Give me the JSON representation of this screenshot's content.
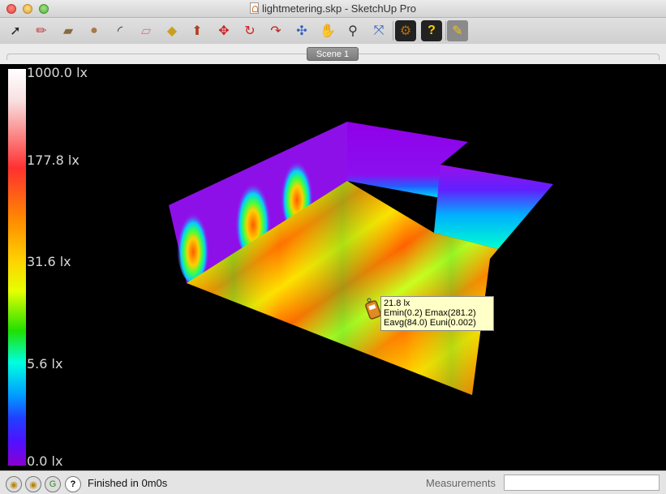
{
  "window": {
    "title": "lightmetering.skp - SketchUp Pro"
  },
  "toolbar": {
    "tools": [
      {
        "name": "select-tool",
        "glyph": "➚"
      },
      {
        "name": "pencil-tool",
        "glyph": "✏"
      },
      {
        "name": "rectangle-tool",
        "glyph": "▰"
      },
      {
        "name": "circle-tool",
        "glyph": "●"
      },
      {
        "name": "arc-tool",
        "glyph": "◜"
      },
      {
        "name": "eraser-tool",
        "glyph": "▱"
      },
      {
        "name": "paint-bucket-tool",
        "glyph": "◆"
      },
      {
        "name": "push-pull-tool",
        "glyph": "⬆"
      },
      {
        "name": "move-tool",
        "glyph": "✥"
      },
      {
        "name": "rotate-tool",
        "glyph": "↻"
      },
      {
        "name": "follow-me-tool",
        "glyph": "↷"
      },
      {
        "name": "orbit-tool",
        "glyph": "✣"
      },
      {
        "name": "pan-tool",
        "glyph": "✋"
      },
      {
        "name": "zoom-tool",
        "glyph": "⚲"
      },
      {
        "name": "zoom-extents-tool",
        "glyph": "⤧"
      },
      {
        "name": "settings-tool",
        "glyph": "⚙"
      },
      {
        "name": "help-tool",
        "glyph": "?"
      },
      {
        "name": "light-meter-tool",
        "glyph": "✎"
      }
    ]
  },
  "scenes": {
    "tabs": [
      "Scene 1"
    ]
  },
  "legend": {
    "labels": [
      "1000.0 lx",
      "177.8 lx",
      "31.6 lx",
      "5.6 lx",
      "0.0 lx"
    ]
  },
  "tooltip": {
    "line1": "21.8 lx",
    "line2": "Emin(0.2) Emax(281.2)",
    "line3": "Eavg(84.0) Euni(0.002)"
  },
  "status": {
    "message": "Finished in 0m0s",
    "measurements_label": "Measurements",
    "measurements_value": ""
  },
  "colors": {
    "floor_hot": "#ff5a00",
    "floor_mid": "#ffd000",
    "floor_cool": "#a6ff00",
    "wall": "#9a10f0",
    "wall_hot": "#ff8000",
    "viewport_bg": "#000000"
  }
}
